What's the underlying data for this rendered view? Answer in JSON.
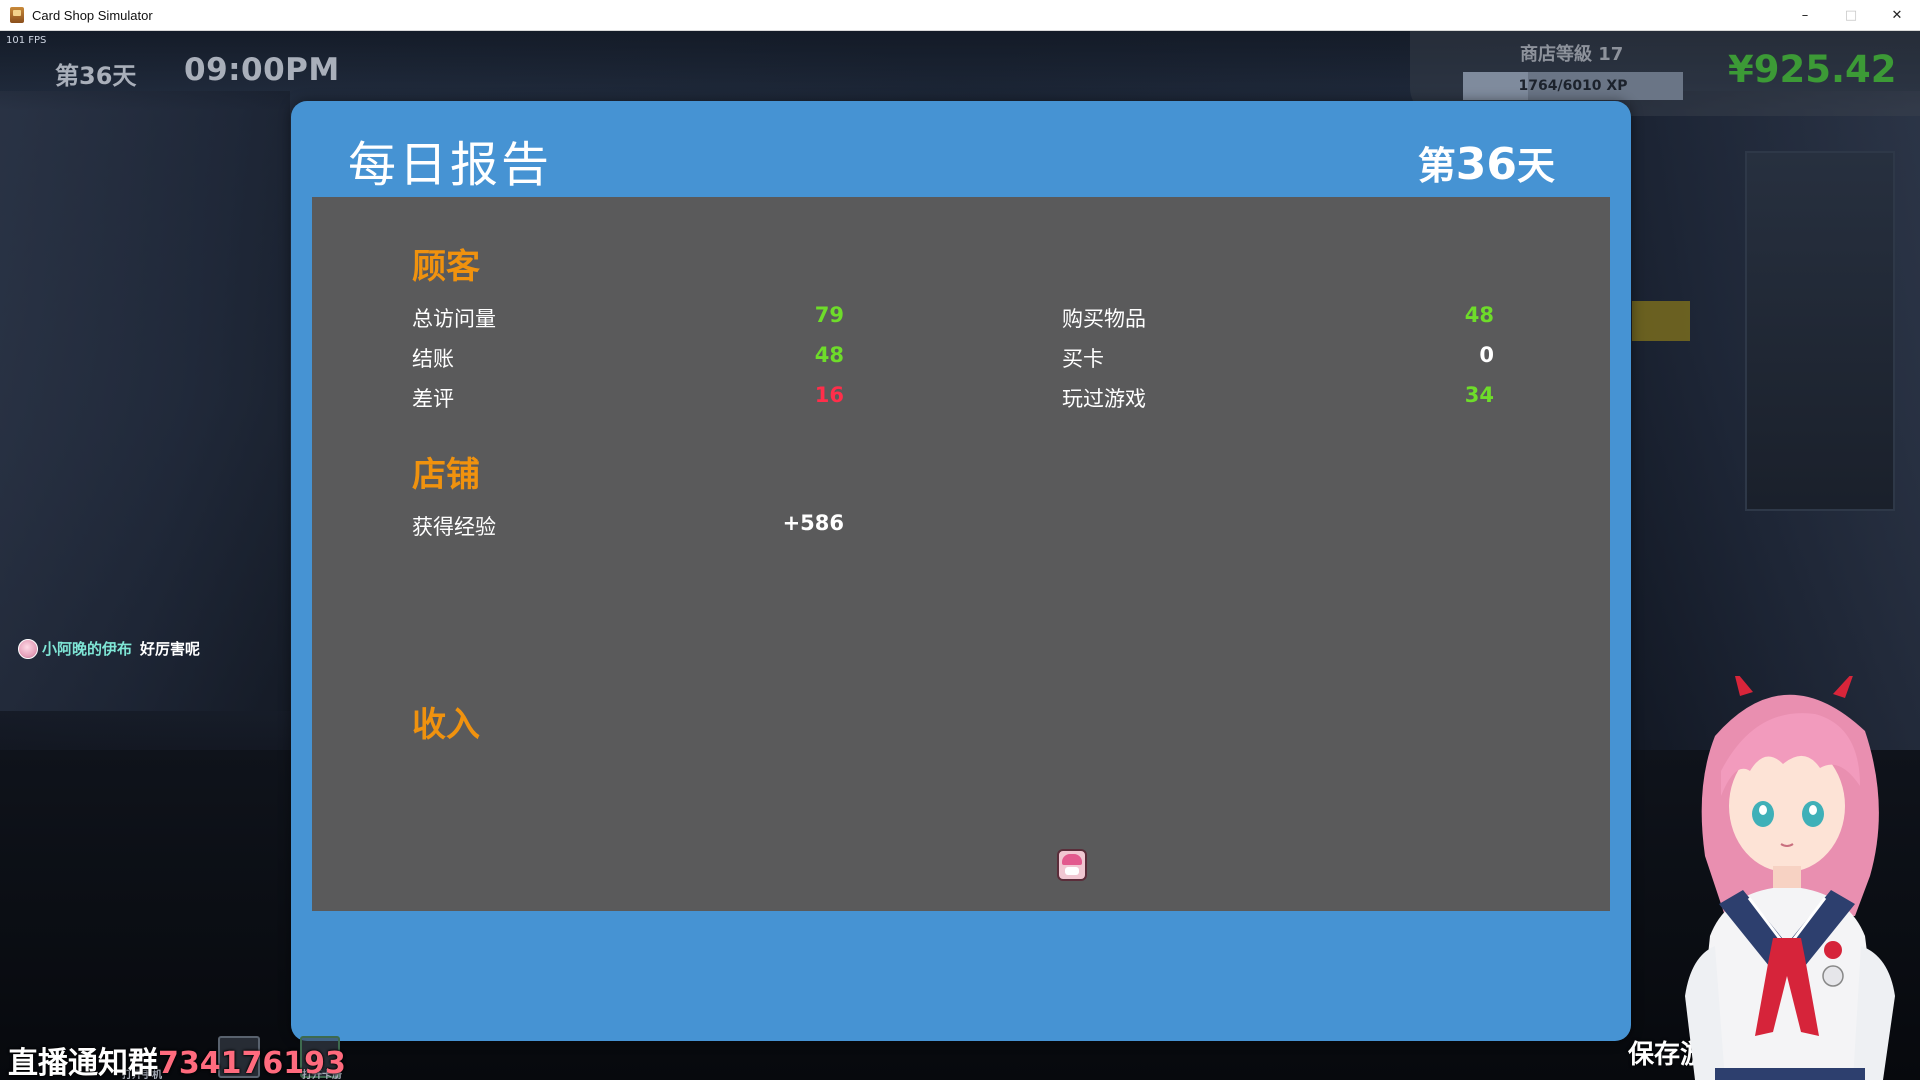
{
  "window": {
    "title": "Card Shop Simulator",
    "minimize": "–",
    "maximize": "□",
    "close": "✕"
  },
  "hud": {
    "fps": "101 FPS",
    "day": "第36天",
    "time": "09:00PM",
    "shop_level": "商店等級 17",
    "xp_text": "1764/6010 XP",
    "xp_progress": 0.2935,
    "money": "¥925.42"
  },
  "report": {
    "title": "每日报告",
    "day_prefix": "第",
    "day_number": "36",
    "day_suffix": "天",
    "sections": {
      "customers": {
        "title": "顾客",
        "left": [
          {
            "label": "总访问量",
            "value": "79",
            "color": "green"
          },
          {
            "label": "结账",
            "value": "48",
            "color": "green"
          },
          {
            "label": "差评",
            "value": "16",
            "color": "red"
          }
        ],
        "right": [
          {
            "label": "购买物品",
            "value": "48",
            "color": "green"
          },
          {
            "label": "买卡",
            "value": "0",
            "color": "white"
          },
          {
            "label": "玩过游戏",
            "value": "34",
            "color": "green"
          }
        ]
      },
      "shop": {
        "title": "店铺",
        "items": [
          {
            "label": "获得经验",
            "value": "+586",
            "color": "white"
          }
        ]
      },
      "income": {
        "title": "收入"
      }
    }
  },
  "chat": {
    "user": "小阿晚的伊布",
    "message": "好厉害呢"
  },
  "overlay": {
    "stream_label": "直播通知群",
    "stream_number": "734176193",
    "hint_phone": "打开手机",
    "hint_album": "打开卡册",
    "save_text": "保存游戏"
  },
  "colors": {
    "dialog_blue": "#4693d3",
    "body_gray": "#5a5a5b",
    "section_orange": "#f0920e",
    "value_green": "#6edc2a",
    "value_red": "#ff2e4a",
    "money_green": "#3c9a36"
  }
}
